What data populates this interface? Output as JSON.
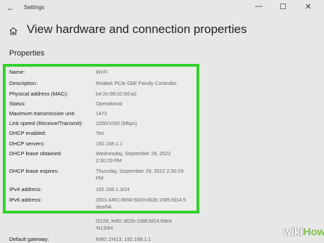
{
  "window": {
    "title": "Settings",
    "back_icon": "back-arrow-icon",
    "controls": [
      "minimize-icon",
      "maximize-icon",
      "close-icon"
    ]
  },
  "page": {
    "title": "View hardware and connection properties",
    "home_icon": "home-icon"
  },
  "section": {
    "title": "Properties"
  },
  "properties": [
    {
      "label": "Name:",
      "value": "Wi-Fi"
    },
    {
      "label": "Description:",
      "value": "Realtek PCIe GbE Family Controller"
    },
    {
      "label": "Physical address (MAC):",
      "value": "b4:2e:99:02:8d:a2"
    },
    {
      "label": "Status:",
      "value": "Operational"
    },
    {
      "label": "Maximum transmission unit:",
      "value": "1472"
    },
    {
      "label": "Link speed (Receive/Transmit):",
      "value": "1000/1000 (Mbps)"
    },
    {
      "label": "DHCP enabled:",
      "value": "Yes"
    },
    {
      "label": "DHCP servers:",
      "value": "192.168.1.1"
    },
    {
      "label": "DHCP lease obtained:",
      "value_line1": "Wednesday, September 28, 2022",
      "value_line2": "2:30:29 PM"
    },
    {
      "label": "DHCP lease expires:",
      "value_line1": "Thursday, September 29, 2022 2:30:29",
      "value_line2": "PM"
    },
    {
      "label": "IPv4 address:",
      "value": "192.168.1.3/24"
    },
    {
      "label": "IPv6 address:",
      "value_line1": "2001:4451:8694:6b00:d02b:1585:fd14:5",
      "value_line2": "dea/64,"
    },
    {
      "value_line1": "0/128, fe80::d02b:1585:fd14:5dea",
      "value_line2": "%13/64"
    },
    {
      "label": "Default gateway:",
      "value": "fe80::1%13, 192.168.1.1"
    }
  ],
  "highlight_color": "#33d12b",
  "watermark": {
    "part1": "wiki",
    "part2": "How"
  }
}
